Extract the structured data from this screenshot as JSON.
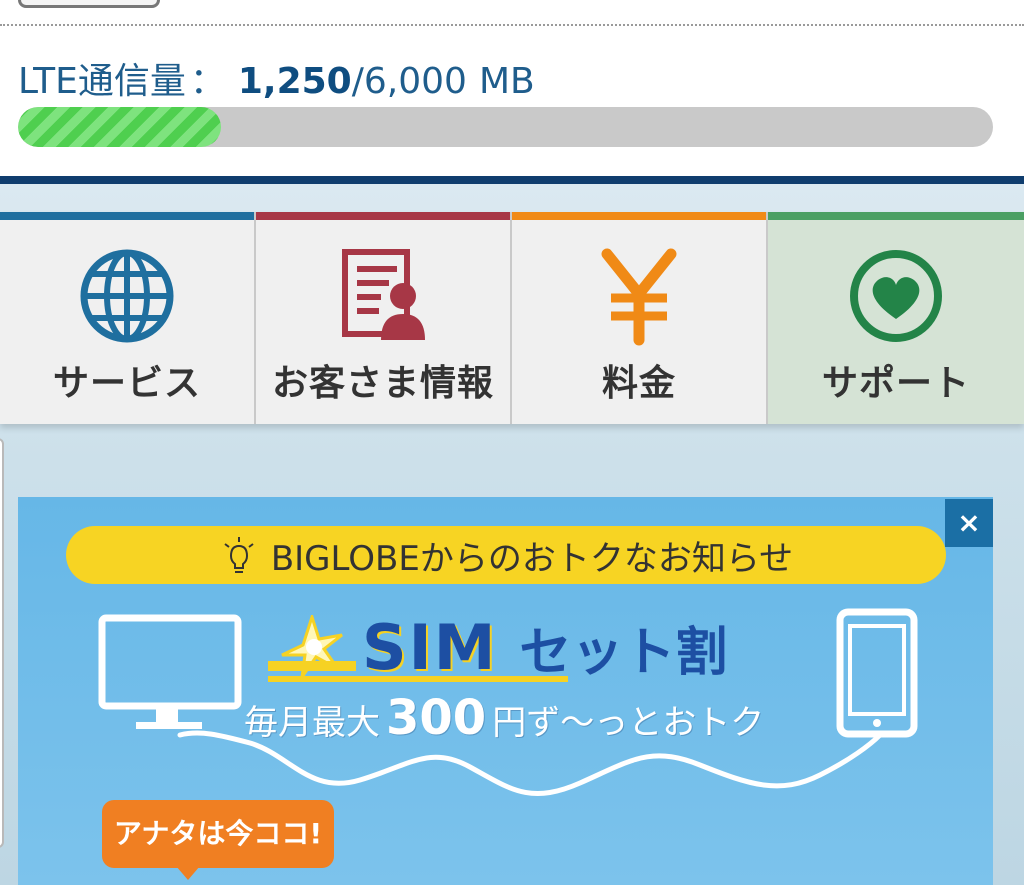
{
  "usage": {
    "label": "LTE通信量",
    "colon": "：",
    "used": "1,250",
    "separator": "/",
    "total": "6,000",
    "unit": "MB",
    "progress_fraction": 0.208
  },
  "nav": {
    "items": [
      {
        "label": "サービス",
        "icon": "globe-icon",
        "color": "#1f6f9f"
      },
      {
        "label": "お客さま情報",
        "icon": "customer-info-icon",
        "color": "#a73746"
      },
      {
        "label": "料金",
        "icon": "yen-icon",
        "color": "#f08a16"
      },
      {
        "label": "サポート",
        "icon": "heart-icon",
        "color": "#238448"
      }
    ]
  },
  "banner": {
    "close_label": "×",
    "notice": "BIGLOBEからのおトクなお知らせ",
    "logo_text": "SIM",
    "headline": "セット割",
    "discount_prefix": "毎月最大",
    "discount_amount": "300",
    "discount_suffix": "円ず〜っとおトク",
    "badge": "アナタは今ココ!"
  },
  "colors": {
    "accent_blue": "#0f3d6e",
    "banner_blue": "#66b7e7",
    "notice_yellow": "#f7d423",
    "badge_orange": "#f07f22",
    "progress_green": "#4fcf4f"
  }
}
